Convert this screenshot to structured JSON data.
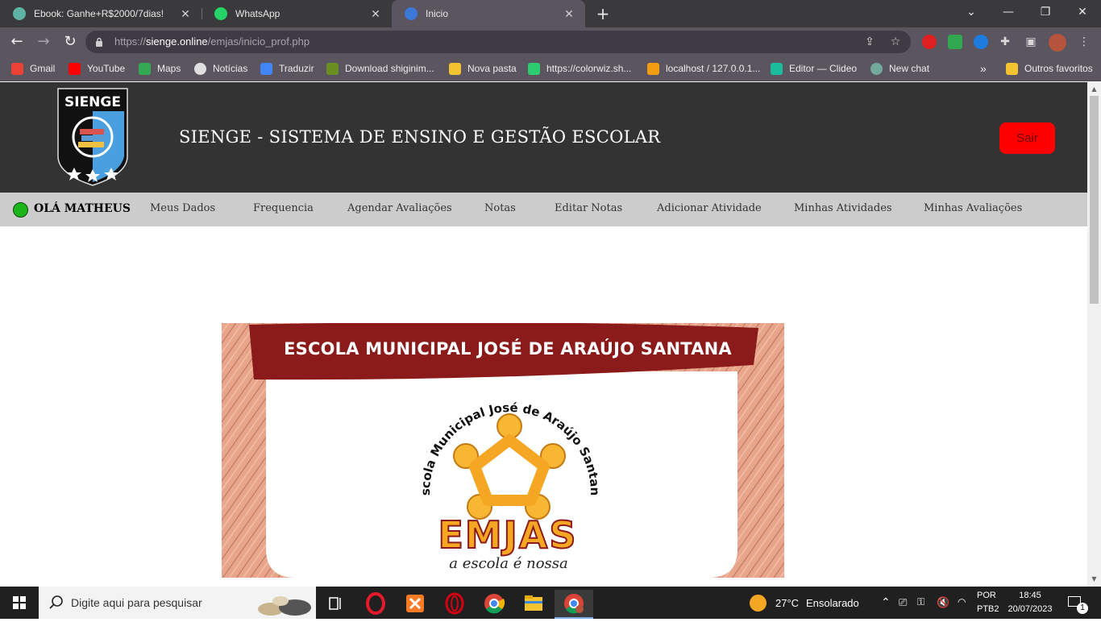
{
  "browser": {
    "tabs": [
      {
        "title": "Ebook: Ganhe+R$2000/7dias! ",
        "favicon_color": "#5fb3a4",
        "active": false
      },
      {
        "title": "WhatsApp",
        "favicon_color": "#25d366",
        "active": false
      },
      {
        "title": "Inicio",
        "favicon_color": "#3c78d8",
        "active": true
      }
    ],
    "close_glyph": "✕",
    "new_tab_glyph": "+",
    "window_controls": {
      "dropdown": "⌄",
      "minimize": "—",
      "restore": "❐",
      "close": "✕"
    },
    "url": {
      "prefix": "https://",
      "host": "sienge.online",
      "path": "/emjas/inicio_prof.php"
    },
    "bookmarks": [
      {
        "label": "Gmail",
        "icon": "gmail-icon",
        "color": "#ea4335"
      },
      {
        "label": "YouTube",
        "icon": "youtube-icon",
        "color": "#ff0000"
      },
      {
        "label": "Maps",
        "icon": "maps-icon",
        "color": "#34a853"
      },
      {
        "label": "Notícias",
        "icon": "news-icon",
        "color": "#e0e0e0"
      },
      {
        "label": "Traduzir",
        "icon": "translate-icon",
        "color": "#4285f4"
      },
      {
        "label": "Download shiginim...",
        "icon": "minecraft-icon",
        "color": "#6b8e23"
      },
      {
        "label": "Nova pasta",
        "icon": "folder-icon",
        "color": "#f4c430"
      },
      {
        "label": "https://colorwiz.sh...",
        "icon": "colorwiz-icon",
        "color": "#2ecc71"
      },
      {
        "label": "localhost / 127.0.0.1...",
        "icon": "phpmyadmin-icon",
        "color": "#f39c12"
      },
      {
        "label": "Editor — Clideo",
        "icon": "clideo-icon",
        "color": "#1abc9c"
      },
      {
        "label": "New chat",
        "icon": "openai-icon",
        "color": "#74aa9c"
      }
    ],
    "bookmarks_overflow": "»",
    "other_favorites": "Outros favoritos"
  },
  "site": {
    "logo_text": "SIENGE",
    "title": "SIENGE - SISTEMA DE ENSINO E GESTÃO ESCOLAR",
    "logout_label": "Sair",
    "greeting": "OLÁ MATHEUS",
    "nav": [
      "Meus Dados",
      "Frequencia",
      "Agendar Avaliações",
      "Notas",
      "Editar Notas",
      "Adicionar Atividade",
      "Minhas Atividades",
      "Minhas Avaliações"
    ],
    "banner": {
      "ribbon": "ESCOLA MUNICIPAL JOSÉ DE ARAÚJO SANTANA",
      "arc_text": "Escola Municipal José de Araújo Santana",
      "brand": "EMJAS",
      "slogan": "a escola é nossa"
    },
    "colors": {
      "header_bg": "#333333",
      "nav_bg": "#cccccc",
      "logout": "#ff0000",
      "online": "#1bb51b",
      "ribbon": "#8b1a1a",
      "brand": "#f5a623"
    }
  },
  "taskbar": {
    "search_placeholder": "Digite aqui para pesquisar",
    "weather_temp": "27°C",
    "weather_text": "Ensolarado",
    "lang_top": "POR",
    "lang_bottom": "PTB2",
    "time": "18:45",
    "date": "20/07/2023",
    "notification_count": "1"
  }
}
